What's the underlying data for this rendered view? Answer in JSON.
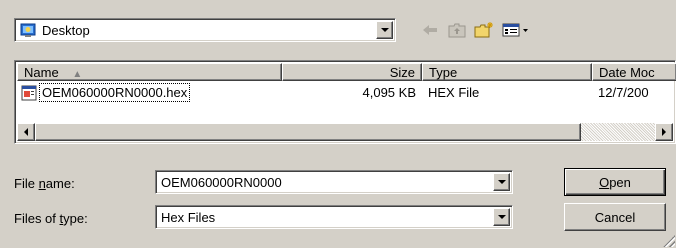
{
  "look_in": {
    "value": "Desktop",
    "icon": "desktop-folder-icon"
  },
  "toolbar": {
    "back_icon": "back-arrow-icon",
    "up_icon": "up-folder-icon",
    "new_folder_icon": "new-folder-icon",
    "view_menu_icon": "view-menu-icon"
  },
  "list": {
    "columns": [
      {
        "label": "Name",
        "sort_indicator": "▲"
      },
      {
        "label": "Size"
      },
      {
        "label": "Type"
      },
      {
        "label": "Date Moc"
      }
    ],
    "rows": [
      {
        "name": "OEM060000RN0000.hex",
        "size": "4,095 KB",
        "type": "HEX File",
        "date": "12/7/200"
      }
    ]
  },
  "file_name": {
    "label_pre": "File ",
    "label_key": "n",
    "label_post": "ame:",
    "value": "OEM060000RN0000"
  },
  "files_of_type": {
    "label_pre": "Files of ",
    "label_key": "t",
    "label_post": "ype:",
    "value": "Hex Files"
  },
  "buttons": {
    "open": {
      "key": "O",
      "rest": "pen"
    },
    "cancel": "Cancel"
  }
}
